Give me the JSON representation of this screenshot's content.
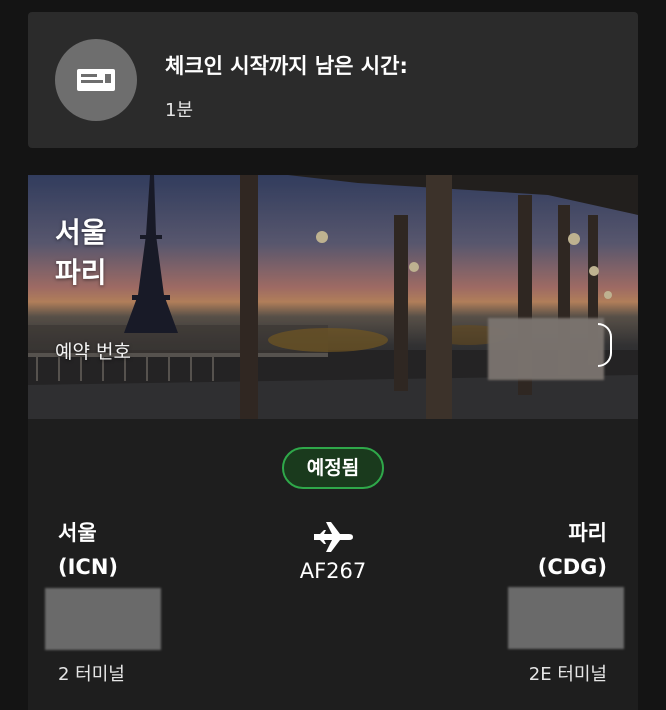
{
  "checkin": {
    "icon": "ticket-icon",
    "title": "체크인 시작까지 남은 시간:",
    "value": "1분"
  },
  "trip": {
    "hero": {
      "origin_city": "서울",
      "destination_city": "파리",
      "booking_label": "예약 번호"
    },
    "status": {
      "label": "예정됨",
      "color": "#2fa84a"
    },
    "origin": {
      "city": "서울",
      "code": "(ICN)",
      "terminal": "2 터미널"
    },
    "destination": {
      "city": "파리",
      "code": "(CDG)",
      "terminal": "2E 터미널"
    },
    "flight": {
      "icon": "airplane-icon",
      "number": "AF267"
    }
  },
  "colors": {
    "background": "#141414",
    "card": "#2b2b2b",
    "status_green": "#2fa84a"
  }
}
